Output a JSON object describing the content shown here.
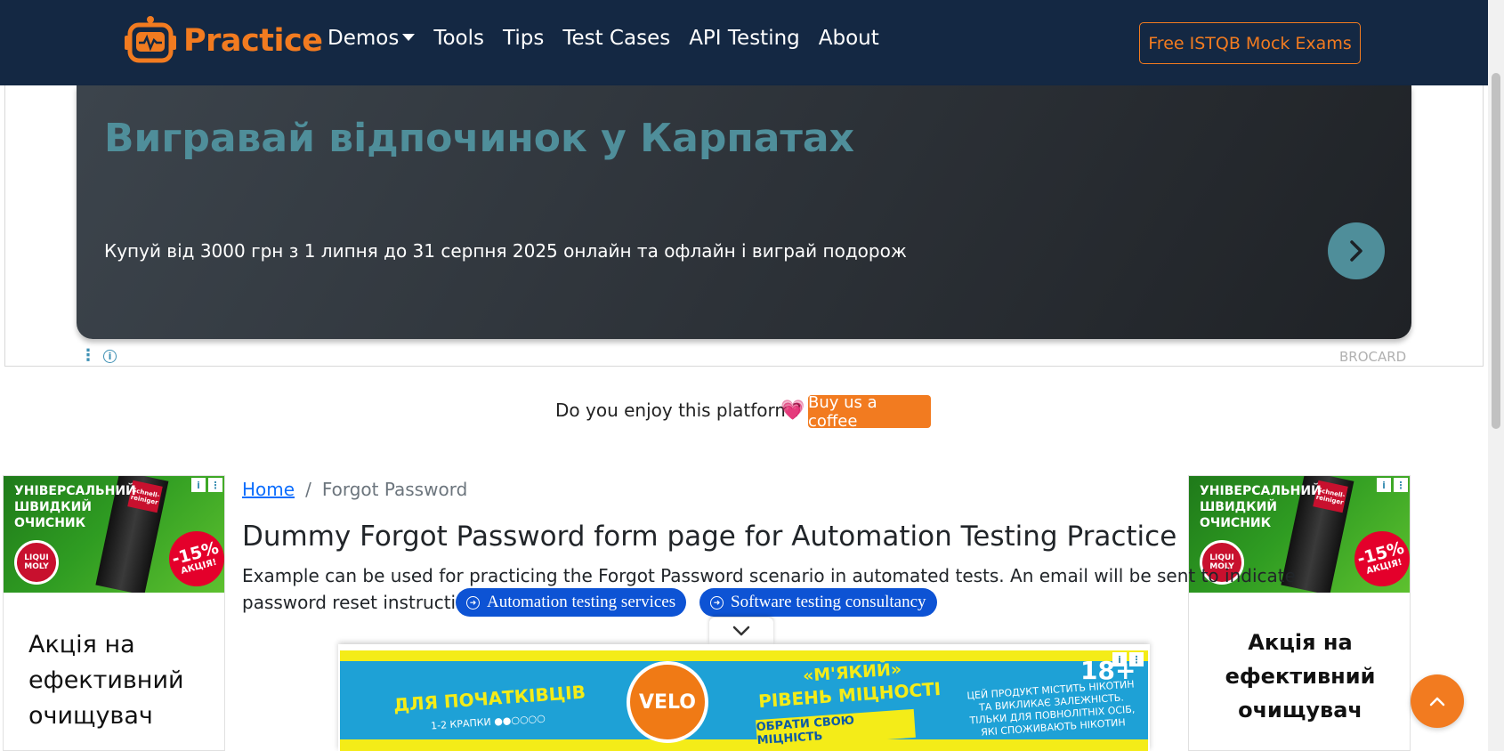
{
  "navbar": {
    "logo_text": "Practice",
    "links": [
      {
        "label": "Demos",
        "has_caret": true
      },
      {
        "label": "Tools"
      },
      {
        "label": "Tips"
      },
      {
        "label": "Test Cases"
      },
      {
        "label": "API Testing"
      },
      {
        "label": "About"
      }
    ],
    "cta_label": "Free ISTQB Mock Exams"
  },
  "top_ad": {
    "headline": "Вигравай відпочинок у Карпатах",
    "subtext": "Купуй від 3000 грн з 1 липня до 31 серпня 2025 онлайн та офлайн і виграй подорож",
    "brand": "BROCARD",
    "dots": "⋮",
    "info": "i"
  },
  "support": {
    "question": "Do you enjoy this platform?",
    "heart": "💗",
    "button_label": "Buy us a coffee"
  },
  "side_ad": {
    "title": "УНІВЕРСАЛЬНИЙ ШВИДКИЙ ОЧИСНИК",
    "brand": "LIQUI MOLY",
    "can_label": "Schnell-reiniger",
    "discount_pct": "-15%",
    "discount_label": "АКЦІЯ!",
    "headline_left": "Акція на ефективний очищувач",
    "headline_right": "Акція на ефективний очищувач"
  },
  "breadcrumb": {
    "home": "Home",
    "separator": "/",
    "current": "Forgot Password"
  },
  "main": {
    "title": "Dummy Forgot Password form page for Automation Testing Practice",
    "description_line1": "Example can be used for practicing the Forgot Password scenario in automated tests. An email will be sent to indicate",
    "description_line2": "password reset instructions",
    "pills": [
      {
        "label": "Automation testing services"
      },
      {
        "label": "Software testing consultancy"
      }
    ]
  },
  "bottom_ad": {
    "left_headline": "ДЛЯ ПОЧАТКІВЦІВ",
    "left_sub": "1-2 КРАПКИ ●●○○○○",
    "brand": "VELO",
    "mid_line1": "«М'ЯКИЙ»",
    "mid_line2": "РІВЕНЬ МІЦНОСТІ",
    "button": "ОБРАТИ СВОЮ МІЦНІСТЬ",
    "age": "18+",
    "warning": "ЦЕЙ ПРОДУКТ МІСТИТЬ НІКОТИН ТА ВИКЛИКАЄ ЗАЛЕЖНІСТЬ. ТІЛЬКИ ДЛЯ ПОВНОЛІТНІХ ОСІБ, ЯКІ СПОЖИВАЮТЬ НІКОТИН"
  },
  "colors": {
    "navbar_bg": "#142843",
    "accent_orange": "#f27b20",
    "link_blue": "#0d6efd",
    "pill_blue": "#0d53d4",
    "ad_teal": "#4f8e9a"
  },
  "icons": {
    "collapse": "chevron-down-icon",
    "scroll_top": "chevron-up-icon",
    "ad_next": "chevron-right-icon"
  }
}
